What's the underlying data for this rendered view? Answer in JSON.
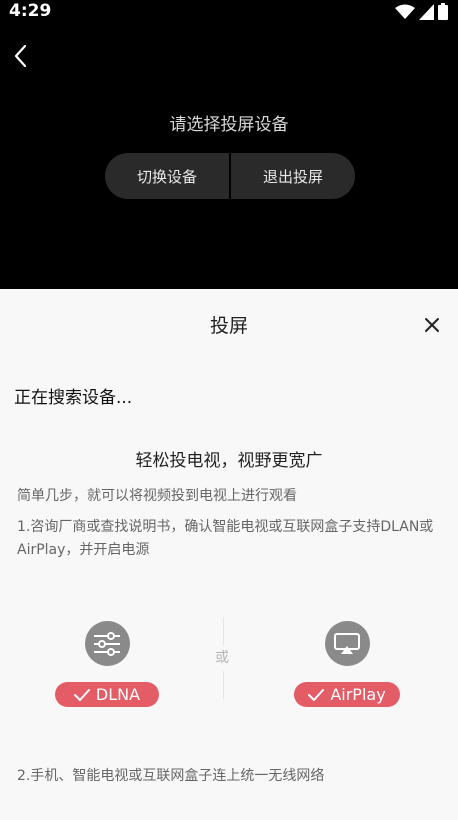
{
  "status_bar": {
    "time": "4:29"
  },
  "header": {
    "title": "请选择投屏设备",
    "switch_device": "切换设备",
    "exit_cast": "退出投屏"
  },
  "sheet": {
    "title": "投屏",
    "searching": "正在搜索设备...",
    "headline": "轻松投电视，视野更宽广",
    "description": "简单几步，就可以将视频投到电视上进行观看",
    "step1": "1.咨询厂商或查找说明书，确认智能电视或互联网盒子支持DLAN或AirPlay，并开启电源",
    "or_label": "或",
    "option_dlna": "DLNA",
    "option_airplay": "AirPlay",
    "step2": "2.手机、智能电视或互联网盒子连上统一无线网络"
  },
  "colors": {
    "accent": "#e35c66",
    "icon_gray": "#8a8a8a"
  }
}
